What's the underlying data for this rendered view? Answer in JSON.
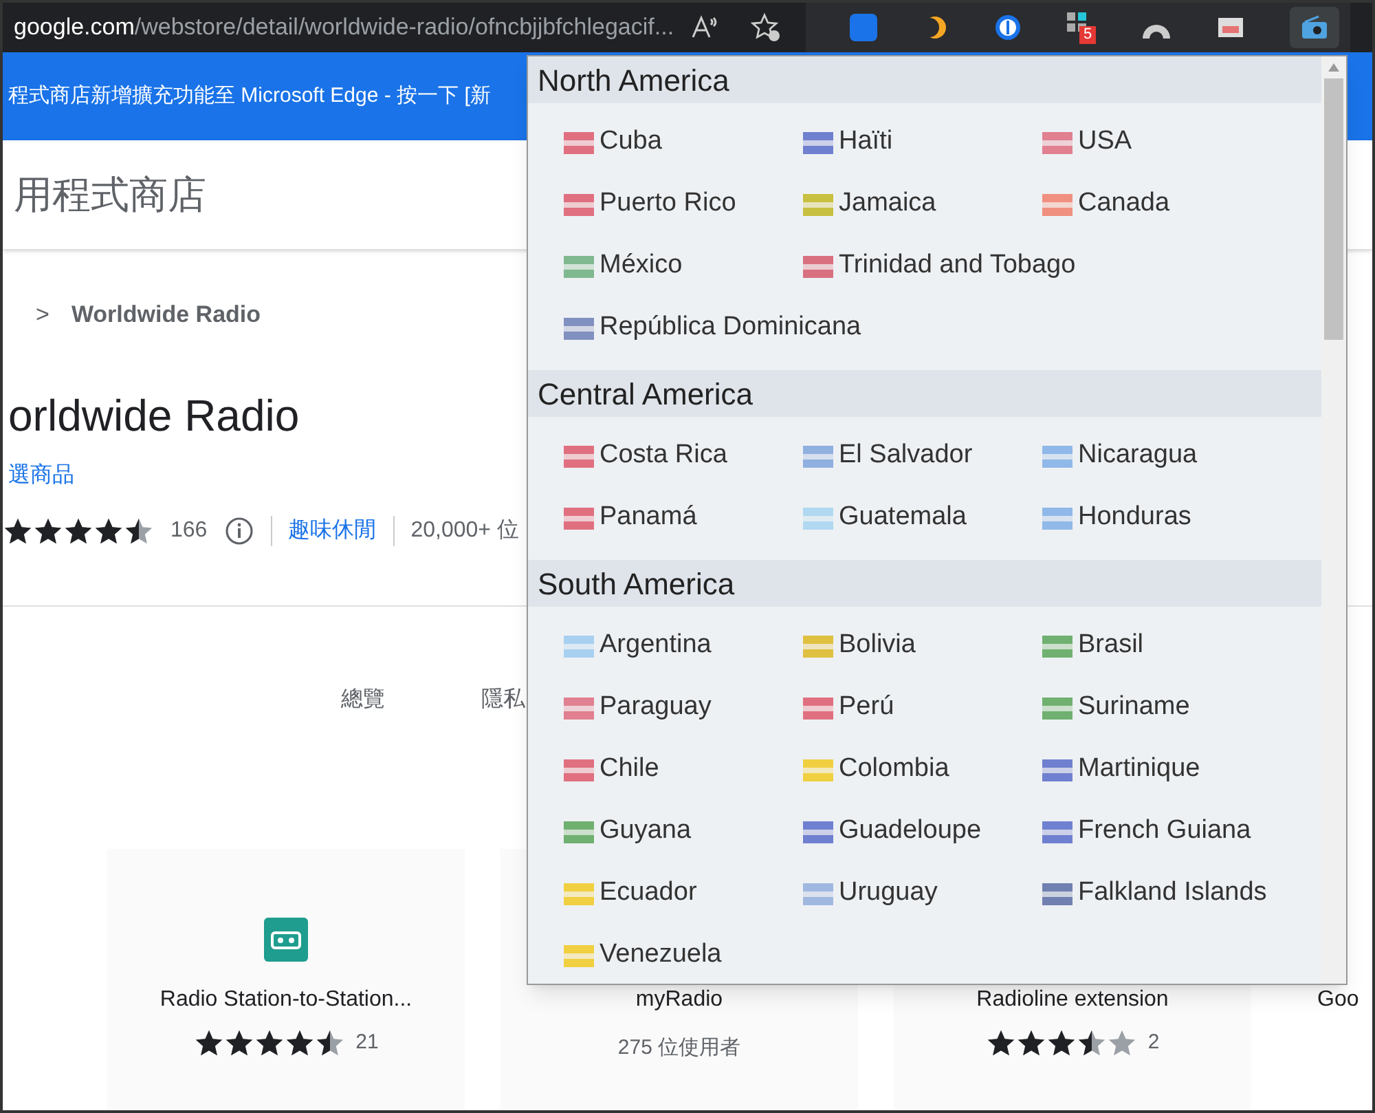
{
  "address_bar": {
    "domain": "google.com",
    "path": "/webstore/detail/worldwide-radio/ofncbjjbfchlegacif...",
    "toolbar_badge": "5"
  },
  "banner": {
    "text": "程式商店新增擴充功能至 Microsoft Edge - 按一下 [新"
  },
  "store_header": {
    "title": "用程式商店"
  },
  "breadcrumb": {
    "separator": ">",
    "current": "Worldwide Radio"
  },
  "extension": {
    "title": "orldwide Radio",
    "badge": "選商品",
    "stars": 4.5,
    "rating_count": "166",
    "category": "趣味休閒",
    "users": "20,000+ 位"
  },
  "page_tabs": [
    {
      "label": "總覽",
      "selected": false
    },
    {
      "label": "隱私",
      "selected": false
    }
  ],
  "related": [
    {
      "title": "Radio Station-to-Station...",
      "stars": 4.5,
      "count": "21",
      "kind": "rated"
    },
    {
      "title": "myRadio",
      "users": "275 位使用者",
      "kind": "users"
    },
    {
      "title": "Radioline extension",
      "stars": 3.5,
      "count": "2",
      "kind": "rated"
    },
    {
      "title": "Goo",
      "kind": "cut"
    }
  ],
  "popup": {
    "sections": [
      {
        "title": "North America",
        "countries": [
          {
            "name": "Cuba",
            "color": "#e07080"
          },
          {
            "name": "Haïti",
            "color": "#7080d0"
          },
          {
            "name": "USA",
            "color": "#e08090"
          },
          {
            "name": "Puerto Rico",
            "color": "#e07080"
          },
          {
            "name": "Jamaica",
            "color": "#c8c040"
          },
          {
            "name": "Canada",
            "color": "#f09080"
          },
          {
            "name": "México",
            "color": "#80b890"
          },
          {
            "name": "Trinidad and Tobago",
            "color": "#d87080"
          },
          {
            "name": "República Dominicana",
            "color": "#8090c0"
          }
        ]
      },
      {
        "title": "Central America",
        "countries": [
          {
            "name": "Costa Rica",
            "color": "#e07080"
          },
          {
            "name": "El Salvador",
            "color": "#90b0e0"
          },
          {
            "name": "Nicaragua",
            "color": "#90b8e8"
          },
          {
            "name": "Panamá",
            "color": "#e07080"
          },
          {
            "name": "Guatemala",
            "color": "#b0d8f0"
          },
          {
            "name": "Honduras",
            "color": "#90b8e8"
          }
        ]
      },
      {
        "title": "South America",
        "countries": [
          {
            "name": "Argentina",
            "color": "#a8d0f0"
          },
          {
            "name": "Bolivia",
            "color": "#e0c040"
          },
          {
            "name": "Brasil",
            "color": "#70b070"
          },
          {
            "name": "Paraguay",
            "color": "#e08090"
          },
          {
            "name": "Perú",
            "color": "#e07080"
          },
          {
            "name": "Suriname",
            "color": "#70b070"
          },
          {
            "name": "Chile",
            "color": "#e07080"
          },
          {
            "name": "Colombia",
            "color": "#f0d040"
          },
          {
            "name": "Martinique",
            "color": "#7080d0"
          },
          {
            "name": "Guyana",
            "color": "#70b070"
          },
          {
            "name": "Guadeloupe",
            "color": "#7080d0"
          },
          {
            "name": "French Guiana",
            "color": "#7080d0"
          },
          {
            "name": "Ecuador",
            "color": "#f0d040"
          },
          {
            "name": "Uruguay",
            "color": "#a0b8e0"
          },
          {
            "name": "Falkland Islands",
            "color": "#7080b0"
          },
          {
            "name": "Venezuela",
            "color": "#f0d040"
          }
        ]
      }
    ]
  }
}
